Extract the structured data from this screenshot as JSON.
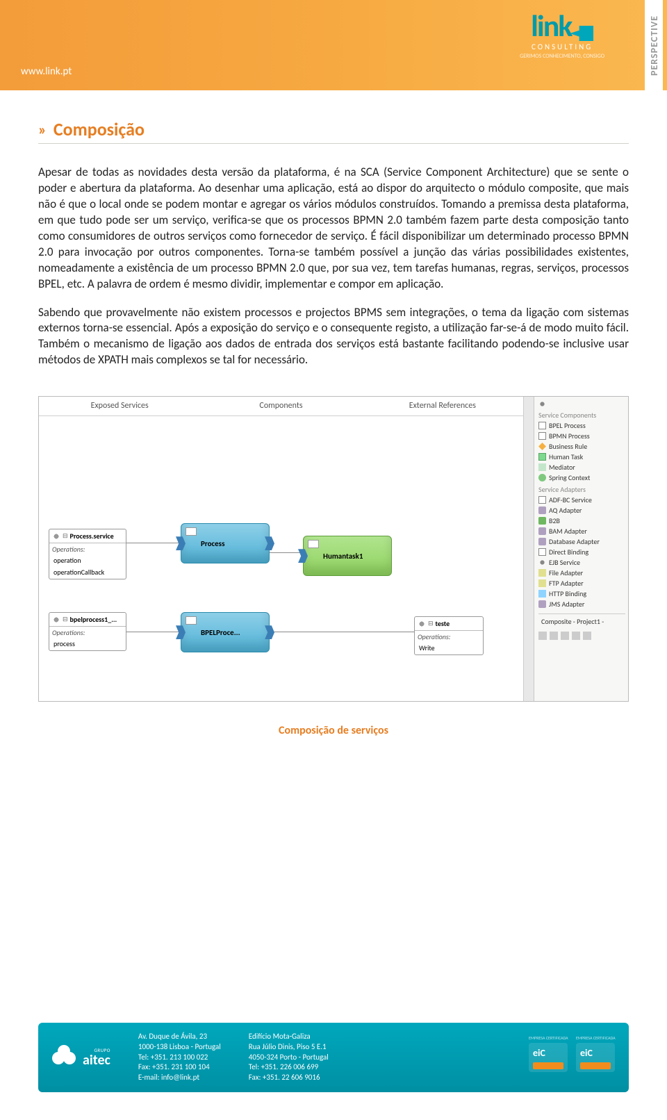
{
  "header": {
    "url": "www.link.pt",
    "logo_text": "link",
    "logo_sub": "CONSULTING",
    "logo_tag": "GERIMOS CONHECIMENTO, CONSIGO",
    "side_label": "PERSPECTIVE"
  },
  "section": {
    "chevron": "»",
    "title": "Composição"
  },
  "paragraphs": {
    "p1": "Apesar de todas as novidades desta versão da plataforma, é na SCA (Service Component Architecture) que se sente o poder e abertura da plataforma. Ao desenhar uma aplicação, está ao dispor do arquitecto o módulo composite, que mais não é que o local onde se podem montar e agregar os vários módulos construídos. Tomando a premissa desta plataforma, em que tudo pode ser um serviço, verifica-se que os processos BPMN 2.0 também fazem parte desta composição tanto como consumidores de outros serviços como fornecedor de serviço. É fácil disponibilizar um determinado processo BPMN 2.0 para invocação por outros componentes. Torna-se também possível a junção das várias possibilidades existentes, nomeadamente a existência de um processo BPMN 2.0 que, por sua vez, tem tarefas humanas, regras, serviços, processos BPEL, etc. A palavra de ordem é mesmo dividir, implementar e compor em aplicação.",
    "p2": "Sabendo que provavelmente não existem processos e projectos BPMS sem integrações, o tema da ligação com sistemas externos torna-se essencial. Após a exposição do serviço e o consequente registo, a utilização far-se-á de modo muito fácil. Também o mecanismo de ligação aos dados de entrada dos serviços está bastante facilitando podendo-se inclusive usar métodos de XPATH mais complexos se tal for necessário."
  },
  "diagram": {
    "cols": {
      "left": "Exposed Services",
      "mid": "Components",
      "right": "External References"
    },
    "svc1": {
      "title": "Process.service",
      "ops_label": "Operations:",
      "op1": "operation",
      "op2": "operationCallback"
    },
    "svc2": {
      "title": "bpelprocess1_...",
      "ops_label": "Operations:",
      "op1": "process"
    },
    "comp1": "Process",
    "comp2": "Humantask1",
    "comp3": "BPELProce...",
    "ext1": {
      "title": "teste",
      "ops_label": "Operations:",
      "op1": "Write"
    },
    "palette": {
      "head1": "Service Components",
      "i1": "BPEL Process",
      "i2": "BPMN Process",
      "i3": "Business Rule",
      "i4": "Human Task",
      "i5": "Mediator",
      "i6": "Spring Context",
      "head2": "Service Adapters",
      "a1": "ADF-BC Service",
      "a2": "AQ Adapter",
      "a3": "B2B",
      "a4": "BAM Adapter",
      "a5": "Database Adapter",
      "a6": "Direct Binding",
      "a7": "EJB Service",
      "a8": "File Adapter",
      "a9": "FTP Adapter",
      "a10": "HTTP Binding",
      "a11": "JMS Adapter",
      "tab": "Composite - Project1 -"
    },
    "caption": "Composição de serviços"
  },
  "footer": {
    "grupo": "GRUPO",
    "logo": "aitec",
    "addr1": {
      "l1": "Av. Duque de Ávila, 23",
      "l2": "1000-138 Lisboa - Portugal",
      "l3": "Tel: +351. 213 100 022",
      "l4": "Fax: +351. 231 100 104",
      "l5": "E-mail: info@link.pt"
    },
    "addr2": {
      "l1": "Edifício Mota-Galiza",
      "l2": "Rua Júlio Dinis, Piso 5 E.1",
      "l3": "4050-324 Porto - Portugal",
      "l4": "Tel: +351. 226 006 699",
      "l5": "Fax: +351. 22 606 9016"
    },
    "cert_label": "EMPRESA CERTIFICADA"
  }
}
